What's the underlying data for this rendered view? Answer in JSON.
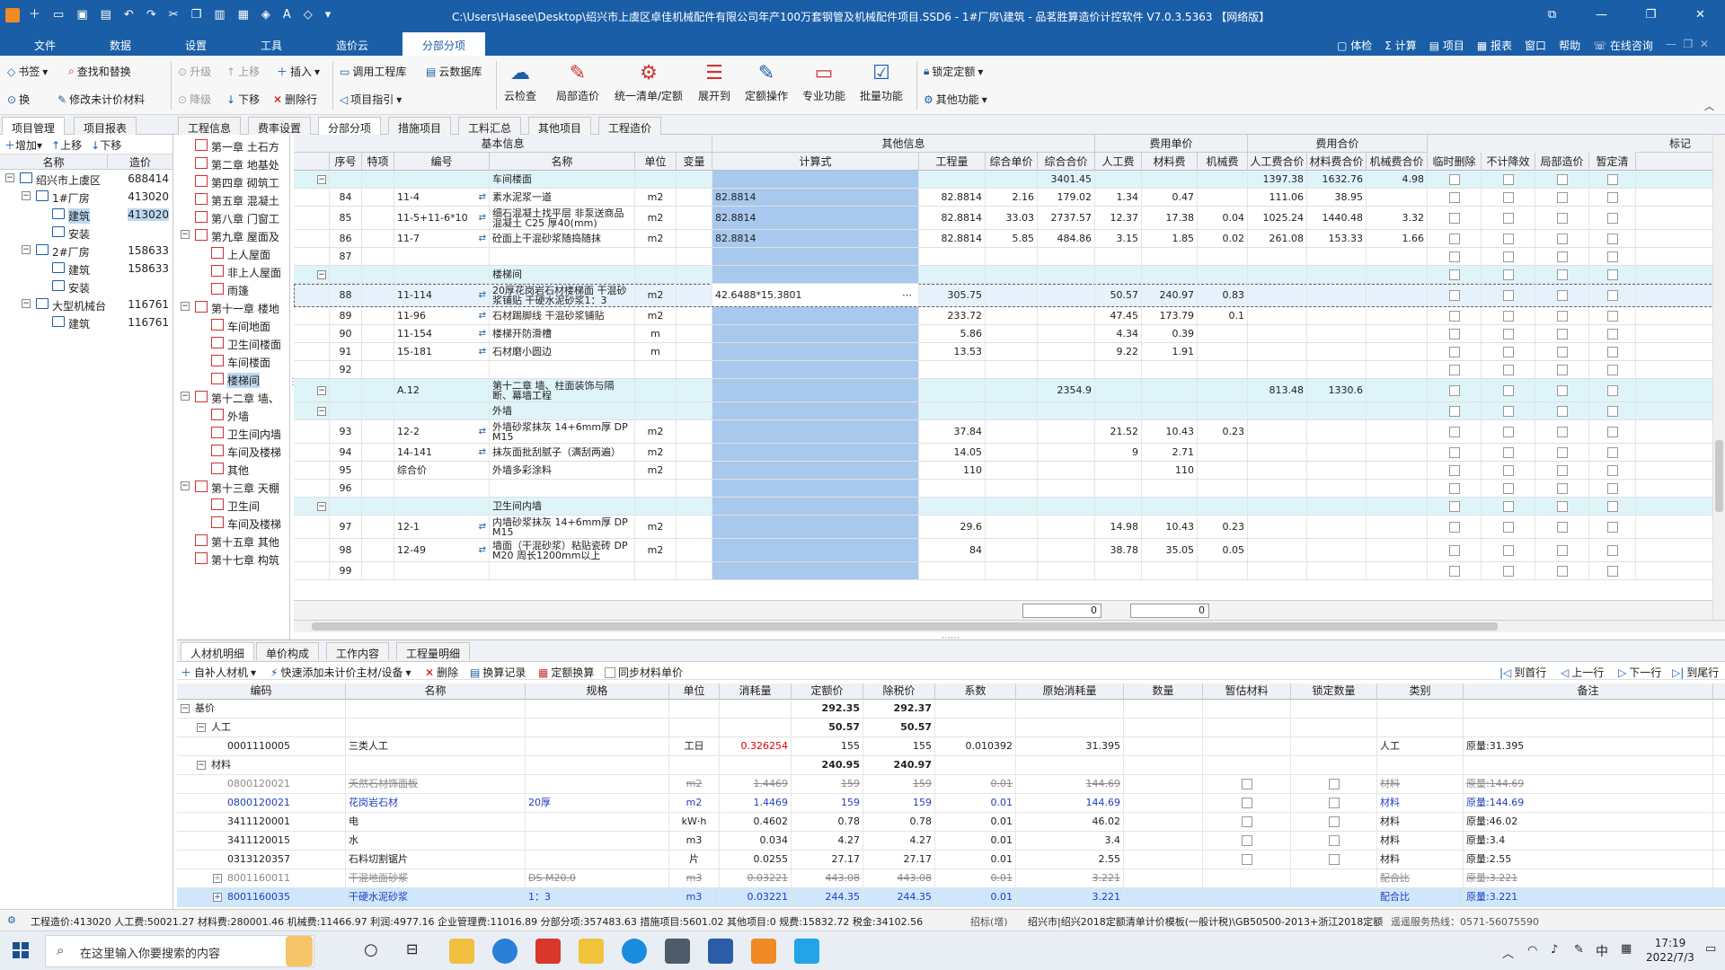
{
  "app": {
    "title": "C:\\Users\\Hasee\\Desktop\\绍兴市上虞区卓佳机械配件有限公司年产100万套钢管及机械配件项目.SSD6 - 1#厂房\\建筑 - 品茗胜算造价计控软件    V7.0.3.5363   【网络版】"
  },
  "menu": {
    "items": [
      "文件",
      "数据",
      "设置",
      "工具",
      "造价云",
      "分部分项"
    ],
    "right": [
      "体检",
      "计算",
      "项目",
      "报表",
      "窗口",
      "帮助",
      "在线咨询"
    ]
  },
  "ribbon": {
    "small": [
      "书签",
      "查找和替换",
      "换",
      "修改未计价材料",
      "升级",
      "上移",
      "插入",
      "降级",
      "下移",
      "删除行",
      "调用工程库",
      "云数据库",
      "项目指引"
    ],
    "big": [
      "云检查",
      "局部造价",
      "统一清单/定额",
      "展开到",
      "定额操作",
      "专业功能",
      "批量功能"
    ],
    "right": [
      "锁定定额",
      "其他功能"
    ]
  },
  "tabs_main": [
    "项目管理",
    "项目报表",
    "工程信息",
    "费率设置",
    "分部分项",
    "措施项目",
    "工料汇总",
    "其他项目",
    "工程造价"
  ],
  "left_panel": {
    "toolbar": [
      "增加",
      "上移",
      "下移"
    ],
    "headers": [
      "名称",
      "造价"
    ],
    "rows": [
      {
        "name": "绍兴市上虞区",
        "value": "688414",
        "level": 0,
        "toggle": "−"
      },
      {
        "name": "1#厂房",
        "value": "413020",
        "level": 1,
        "toggle": "−"
      },
      {
        "name": "建筑",
        "value": "413020",
        "level": 2,
        "toggle": ""
      },
      {
        "name": "安装",
        "value": "",
        "level": 2,
        "toggle": ""
      },
      {
        "name": "2#厂房",
        "value": "158633",
        "level": 1,
        "toggle": "−"
      },
      {
        "name": "建筑",
        "value": "158633",
        "level": 2,
        "toggle": ""
      },
      {
        "name": "安装",
        "value": "",
        "level": 2,
        "toggle": ""
      },
      {
        "name": "大型机械台",
        "value": "116761",
        "level": 1,
        "toggle": "−"
      },
      {
        "name": "建筑",
        "value": "116761",
        "level": 2,
        "toggle": ""
      }
    ]
  },
  "chapters": [
    {
      "label": "第一章 土石方",
      "level": 0,
      "toggle": ""
    },
    {
      "label": "第二章 地基处",
      "level": 0,
      "toggle": ""
    },
    {
      "label": "第四章 砌筑工",
      "level": 0,
      "toggle": ""
    },
    {
      "label": "第五章 混凝土",
      "level": 0,
      "toggle": ""
    },
    {
      "label": "第八章 门窗工",
      "level": 0,
      "toggle": ""
    },
    {
      "label": "第九章 屋面及",
      "level": 0,
      "toggle": "−"
    },
    {
      "label": "上人屋面",
      "level": 1,
      "toggle": ""
    },
    {
      "label": "非上人屋面",
      "level": 1,
      "toggle": ""
    },
    {
      "label": "雨篷",
      "level": 1,
      "toggle": ""
    },
    {
      "label": "第十一章 楼地",
      "level": 0,
      "toggle": "−"
    },
    {
      "label": "车间地面",
      "level": 1,
      "toggle": ""
    },
    {
      "label": "卫生间楼面",
      "level": 1,
      "toggle": ""
    },
    {
      "label": "车间楼面",
      "level": 1,
      "toggle": ""
    },
    {
      "label": "楼梯间",
      "level": 1,
      "toggle": ""
    },
    {
      "label": "第十二章 墙、",
      "level": 0,
      "toggle": "−"
    },
    {
      "label": "外墙",
      "level": 1,
      "toggle": ""
    },
    {
      "label": "卫生间内墙",
      "level": 1,
      "toggle": ""
    },
    {
      "label": "车间及楼梯",
      "level": 1,
      "toggle": ""
    },
    {
      "label": "其他",
      "level": 1,
      "toggle": ""
    },
    {
      "label": "第十三章 天棚",
      "level": 0,
      "toggle": "−"
    },
    {
      "label": "卫生间",
      "level": 1,
      "toggle": ""
    },
    {
      "label": "车间及楼梯",
      "level": 1,
      "toggle": ""
    },
    {
      "label": "第十五章 其他",
      "level": 0,
      "toggle": ""
    },
    {
      "label": "第十七章 构筑",
      "level": 0,
      "toggle": ""
    }
  ],
  "grid": {
    "group_headers": [
      "基本信息",
      "其他信息",
      "费用单价",
      "费用合价",
      "标记"
    ],
    "headers": [
      "序号",
      "特项",
      "编号",
      "名称",
      "单位",
      "变量",
      "计算式",
      "工程量",
      "综合单价",
      "综合合价",
      "人工费",
      "材料费",
      "机械费",
      "人工费合价",
      "材料费合价",
      "机械费合价",
      "临时删除",
      "不计降效",
      "局部造价",
      "暂定清"
    ],
    "rows": [
      {
        "type": "grp",
        "toggle": "−",
        "no": "",
        "code": "",
        "name": "车间楼面",
        "unit": "",
        "calc": "",
        "qty": "",
        "uprice": "",
        "total": "3401.45",
        "lab": "",
        "mat": "",
        "mach": "",
        "labt": "1397.38",
        "matt": "1632.76",
        "macht": "4.98"
      },
      {
        "type": "row",
        "no": "84",
        "code": "11-4",
        "name": "素水泥浆一道",
        "unit": "m2",
        "calc": "82.8814",
        "qty": "82.8814",
        "uprice": "2.16",
        "total": "179.02",
        "lab": "1.34",
        "mat": "0.47",
        "mach": "",
        "labt": "111.06",
        "matt": "38.95",
        "macht": ""
      },
      {
        "type": "row",
        "no": "85",
        "code": "11-5+11-6*10",
        "name": "细石混凝土找平层 非泵送商品混凝土 C25 厚40(mm)",
        "unit": "m2",
        "calc": "82.8814",
        "qty": "82.8814",
        "uprice": "33.03",
        "total": "2737.57",
        "lab": "12.37",
        "mat": "17.38",
        "mach": "0.04",
        "labt": "1025.24",
        "matt": "1440.48",
        "macht": "3.32"
      },
      {
        "type": "row",
        "no": "86",
        "code": "11-7",
        "name": "砼面上干混砂浆随捣随抹",
        "unit": "m2",
        "calc": "82.8814",
        "qty": "82.8814",
        "uprice": "5.85",
        "total": "484.86",
        "lab": "3.15",
        "mat": "1.85",
        "mach": "0.02",
        "labt": "261.08",
        "matt": "153.33",
        "macht": "1.66"
      },
      {
        "type": "row",
        "no": "87",
        "code": "",
        "name": "",
        "unit": "",
        "calc": "",
        "qty": "",
        "uprice": "",
        "total": "",
        "lab": "",
        "mat": "",
        "mach": "",
        "labt": "",
        "matt": "",
        "macht": ""
      },
      {
        "type": "grp",
        "toggle": "−",
        "no": "",
        "code": "",
        "name": "楼梯间",
        "unit": "",
        "calc": "",
        "qty": "",
        "uprice": "",
        "total": "",
        "lab": "",
        "mat": "",
        "mach": "",
        "labt": "",
        "matt": "",
        "macht": ""
      },
      {
        "type": "sel",
        "no": "88",
        "code": "11-114",
        "name": "20厚花岗岩石材楼梯面 干混砂浆铺贴 干硬水泥砂浆1：3",
        "unit": "m2",
        "calc": "42.6488*15.3801",
        "qty": "305.75",
        "uprice": "",
        "total": "",
        "lab": "50.57",
        "mat": "240.97",
        "mach": "0.83",
        "labt": "",
        "matt": "",
        "macht": ""
      },
      {
        "type": "row",
        "no": "89",
        "code": "11-96",
        "name": "石材踢脚线 干混砂浆铺贴",
        "unit": "m2",
        "calc": "",
        "qty": "233.72",
        "uprice": "",
        "total": "",
        "lab": "47.45",
        "mat": "173.79",
        "mach": "0.1",
        "labt": "",
        "matt": "",
        "macht": ""
      },
      {
        "type": "row",
        "no": "90",
        "code": "11-154",
        "name": "楼梯开防滑槽",
        "unit": "m",
        "calc": "",
        "qty": "5.86",
        "uprice": "",
        "total": "",
        "lab": "4.34",
        "mat": "0.39",
        "mach": "",
        "labt": "",
        "matt": "",
        "macht": ""
      },
      {
        "type": "row",
        "no": "91",
        "code": "15-181",
        "name": "石材磨小圆边",
        "unit": "m",
        "calc": "",
        "qty": "13.53",
        "uprice": "",
        "total": "",
        "lab": "9.22",
        "mat": "1.91",
        "mach": "",
        "labt": "",
        "matt": "",
        "macht": ""
      },
      {
        "type": "row",
        "no": "92",
        "code": "",
        "name": "",
        "unit": "",
        "calc": "",
        "qty": "",
        "uprice": "",
        "total": "",
        "lab": "",
        "mat": "",
        "mach": "",
        "labt": "",
        "matt": "",
        "macht": ""
      },
      {
        "type": "chap",
        "toggle": "−",
        "no": "",
        "code": "A.12",
        "name": "第十二章 墙、柱面装饰与隔断、幕墙工程",
        "unit": "",
        "calc": "",
        "qty": "",
        "uprice": "",
        "total": "2354.9",
        "lab": "",
        "mat": "",
        "mach": "",
        "labt": "813.48",
        "matt": "1330.6",
        "macht": ""
      },
      {
        "type": "grp",
        "toggle": "−",
        "no": "",
        "code": "",
        "name": "外墙",
        "unit": "",
        "calc": "",
        "qty": "",
        "uprice": "",
        "total": "",
        "lab": "",
        "mat": "",
        "mach": "",
        "labt": "",
        "matt": "",
        "macht": ""
      },
      {
        "type": "row",
        "no": "93",
        "code": "12-2",
        "name": "外墙砂浆抹灰 14+6mm厚 DP M15",
        "unit": "m2",
        "calc": "",
        "qty": "37.84",
        "uprice": "",
        "total": "",
        "lab": "21.52",
        "mat": "10.43",
        "mach": "0.23",
        "labt": "",
        "matt": "",
        "macht": ""
      },
      {
        "type": "row",
        "no": "94",
        "code": "14-141",
        "name": "抹灰面批刮腻子（满刮两遍）",
        "unit": "m2",
        "calc": "",
        "qty": "14.05",
        "uprice": "",
        "total": "",
        "lab": "9",
        "mat": "2.71",
        "mach": "",
        "labt": "",
        "matt": "",
        "macht": ""
      },
      {
        "type": "row",
        "no": "95",
        "code": "综合价",
        "name": "外墙多彩涂料",
        "unit": "m2",
        "calc": "",
        "qty": "110",
        "uprice": "",
        "total": "",
        "lab": "",
        "mat": "110",
        "mach": "",
        "labt": "",
        "matt": "",
        "macht": ""
      },
      {
        "type": "row",
        "no": "96",
        "code": "",
        "name": "",
        "unit": "",
        "calc": "",
        "qty": "",
        "uprice": "",
        "total": "",
        "lab": "",
        "mat": "",
        "mach": "",
        "labt": "",
        "matt": "",
        "macht": ""
      },
      {
        "type": "grp",
        "toggle": "−",
        "no": "",
        "code": "",
        "name": "卫生间内墙",
        "unit": "",
        "calc": "",
        "qty": "",
        "uprice": "",
        "total": "",
        "lab": "",
        "mat": "",
        "mach": "",
        "labt": "",
        "matt": "",
        "macht": ""
      },
      {
        "type": "row",
        "no": "97",
        "code": "12-1",
        "name": "内墙砂浆抹灰 14+6mm厚 DP M15",
        "unit": "m2",
        "calc": "",
        "qty": "29.6",
        "uprice": "",
        "total": "",
        "lab": "14.98",
        "mat": "10.43",
        "mach": "0.23",
        "labt": "",
        "matt": "",
        "macht": ""
      },
      {
        "type": "row",
        "no": "98",
        "code": "12-49",
        "name": "墙面（干混砂浆）粘贴瓷砖 DP M20 周长1200mm以上",
        "unit": "m2",
        "calc": "",
        "qty": "84",
        "uprice": "",
        "total": "",
        "lab": "38.78",
        "mat": "35.05",
        "mach": "0.05",
        "labt": "",
        "matt": "",
        "macht": ""
      },
      {
        "type": "row",
        "no": "99",
        "code": "",
        "name": "",
        "unit": "",
        "calc": "",
        "qty": "",
        "uprice": "",
        "total": "",
        "lab": "",
        "mat": "",
        "mach": "",
        "labt": "",
        "matt": "",
        "macht": ""
      }
    ],
    "totals": [
      "0",
      "0"
    ]
  },
  "bottom": {
    "tabs": [
      "人材机明细",
      "单价构成",
      "工作内容",
      "工程量明细"
    ],
    "toolbar": [
      "自补人材机",
      "快速添加未计价主材/设备",
      "删除",
      "换算记录",
      "定额换算",
      "同步材料单价"
    ],
    "nav": [
      "到首行",
      "上一行",
      "下一行",
      "到尾行"
    ],
    "headers": [
      "编码",
      "名称",
      "规格",
      "单位",
      "消耗量",
      "定额价",
      "除税价",
      "系数",
      "原始消耗量",
      "数量",
      "暂估材料",
      "锁定数量",
      "类别",
      "备注"
    ],
    "rows": [
      {
        "style": "bold",
        "toggle": "−",
        "indent": 0,
        "code": "基价",
        "name": "",
        "spec": "",
        "unit": "",
        "qty": "",
        "price": "292.35",
        "net": "292.37",
        "coef": "",
        "orig": "",
        "num": "",
        "cb": false,
        "cat": "",
        "note": ""
      },
      {
        "style": "bold",
        "toggle": "−",
        "indent": 1,
        "code": "人工",
        "name": "",
        "spec": "",
        "unit": "",
        "qty": "",
        "price": "50.57",
        "net": "50.57",
        "coef": "",
        "orig": "",
        "num": "",
        "cb": false,
        "cat": "",
        "note": ""
      },
      {
        "style": "normal",
        "toggle": "",
        "indent": 2,
        "code": "0001110005",
        "name": "三类人工",
        "spec": "",
        "unit": "工日",
        "qty": "0.326254",
        "price": "155",
        "net": "155",
        "coef": "0.010392",
        "orig": "31.395",
        "num": "",
        "cb": false,
        "cat": "人工",
        "note": "原量:31.395"
      },
      {
        "style": "bold",
        "toggle": "−",
        "indent": 1,
        "code": "材料",
        "name": "",
        "spec": "",
        "unit": "",
        "qty": "",
        "price": "240.95",
        "net": "240.97",
        "coef": "",
        "orig": "",
        "num": "",
        "cb": false,
        "cat": "",
        "note": ""
      },
      {
        "style": "strike",
        "toggle": "",
        "indent": 2,
        "code": "0800120021",
        "name": "天然石材饰面板",
        "spec": "",
        "unit": "m2",
        "qty": "1.4469",
        "price": "159",
        "net": "159",
        "coef": "0.01",
        "orig": "144.69",
        "num": "",
        "cb": true,
        "cat": "材料",
        "note": "原量:144.69"
      },
      {
        "style": "blue",
        "toggle": "",
        "indent": 2,
        "code": "0800120021",
        "name": "花岗岩石材",
        "spec": "20厚",
        "unit": "m2",
        "qty": "1.4469",
        "price": "159",
        "net": "159",
        "coef": "0.01",
        "orig": "144.69",
        "num": "",
        "cb": true,
        "cat": "材料",
        "note": "原量:144.69"
      },
      {
        "style": "normal",
        "toggle": "",
        "indent": 2,
        "code": "3411120001",
        "name": "电",
        "spec": "",
        "unit": "kW·h",
        "qty": "0.4602",
        "price": "0.78",
        "net": "0.78",
        "coef": "0.01",
        "orig": "46.02",
        "num": "",
        "cb": true,
        "cat": "材料",
        "note": "原量:46.02"
      },
      {
        "style": "normal",
        "toggle": "",
        "indent": 2,
        "code": "3411120015",
        "name": "水",
        "spec": "",
        "unit": "m3",
        "qty": "0.034",
        "price": "4.27",
        "net": "4.27",
        "coef": "0.01",
        "orig": "3.4",
        "num": "",
        "cb": true,
        "cat": "材料",
        "note": "原量:3.4"
      },
      {
        "style": "normal",
        "toggle": "",
        "indent": 2,
        "code": "0313120357",
        "name": "石料切割锯片",
        "spec": "",
        "unit": "片",
        "qty": "0.0255",
        "price": "27.17",
        "net": "27.17",
        "coef": "0.01",
        "orig": "2.55",
        "num": "",
        "cb": true,
        "cat": "材料",
        "note": "原量:2.55"
      },
      {
        "style": "strike",
        "toggle": "+",
        "indent": 2,
        "code": "8001160011",
        "name": "干混地面砂浆",
        "spec": "DS M20.0",
        "unit": "m3",
        "qty": "0.03221",
        "price": "443.08",
        "net": "443.08",
        "coef": "0.01",
        "orig": "3.221",
        "num": "",
        "cb": false,
        "cat": "配合比",
        "note": "原量:3.221"
      },
      {
        "style": "blue-sel",
        "toggle": "+",
        "indent": 2,
        "code": "8001160035",
        "name": "干硬水泥砂浆",
        "spec": "1：3",
        "unit": "m3",
        "qty": "0.03221",
        "price": "244.35",
        "net": "244.35",
        "coef": "0.01",
        "orig": "3.221",
        "num": "",
        "cb": false,
        "cat": "配合比",
        "note": "原量:3.221"
      }
    ]
  },
  "status": {
    "text": "工程造价:413020 人工费:50021.27 材料费:280001.46 机械费:11466.97 利润:4977.16 企业管理费:11016.89 分部分项:357483.63 措施项目:5601.02 其他项目:0 规费:15832.72 税金:34102.56",
    "mode": "招标(增)",
    "template": "绍兴市|绍兴2018定额清单计价模板(一般计税)\\GB50500-2013+浙江2018定额",
    "hotline": "遥遥服务热线：0571-56075590"
  },
  "taskbar": {
    "search_placeholder": "在这里输入你要搜索的内容",
    "time": "17:19",
    "date": "2022/7/3",
    "ime": "中"
  },
  "colors": {
    "title_bg": "#1b5ea8",
    "group_row": "#dff4f8",
    "calc_col": "#a8c8ee",
    "selected": "#cfe6fb"
  }
}
